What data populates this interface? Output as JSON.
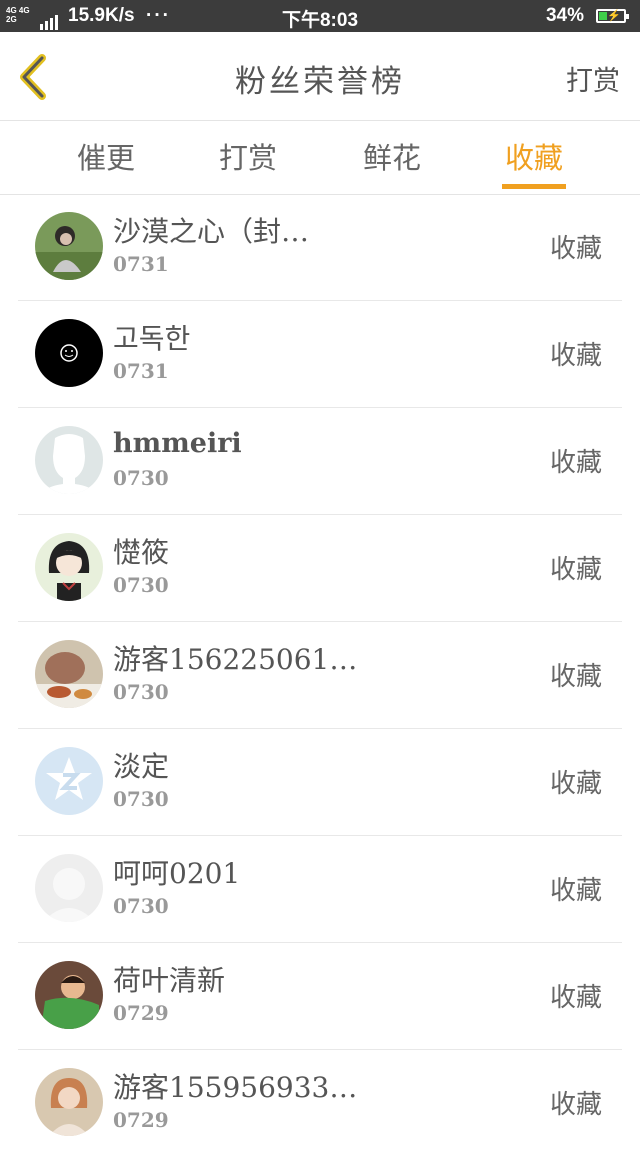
{
  "status_bar": {
    "network_label": "4G 4G\n2G",
    "speed": "15.9K/s",
    "dots": "···",
    "time": "下午8:03",
    "battery_percent": "34%",
    "battery_level": 0.34,
    "battery_color": "#3fce4a"
  },
  "header": {
    "title": "粉丝荣誉榜",
    "right_action": "打赏"
  },
  "tabs": [
    {
      "label": "催更",
      "active": false
    },
    {
      "label": "打赏",
      "active": false
    },
    {
      "label": "鲜花",
      "active": false
    },
    {
      "label": "收藏",
      "active": true
    }
  ],
  "accent_color": "#f0a020",
  "list": [
    {
      "name": "沙漠之心（封…",
      "date": "0731",
      "action": "收藏",
      "avatar": "photo-girl-grass"
    },
    {
      "name": "고독한",
      "date": "0731",
      "action": "收藏",
      "avatar": "black-smiley"
    },
    {
      "name": "hmmeiri",
      "date": "0730",
      "action": "收藏",
      "avatar": "default-silhouette"
    },
    {
      "name": "憷筱",
      "date": "0730",
      "action": "收藏",
      "avatar": "anime-girl"
    },
    {
      "name": "游客156225061…",
      "date": "0730",
      "action": "收藏",
      "avatar": "photo-dog-food"
    },
    {
      "name": "淡定",
      "date": "0730",
      "action": "收藏",
      "avatar": "qq-logo"
    },
    {
      "name": "呵呵0201",
      "date": "0730",
      "action": "收藏",
      "avatar": "default-white"
    },
    {
      "name": "荷叶清新",
      "date": "0729",
      "action": "收藏",
      "avatar": "photo-boy-green"
    },
    {
      "name": "游客155956933…",
      "date": "0729",
      "action": "收藏",
      "avatar": "photo-woman"
    }
  ]
}
